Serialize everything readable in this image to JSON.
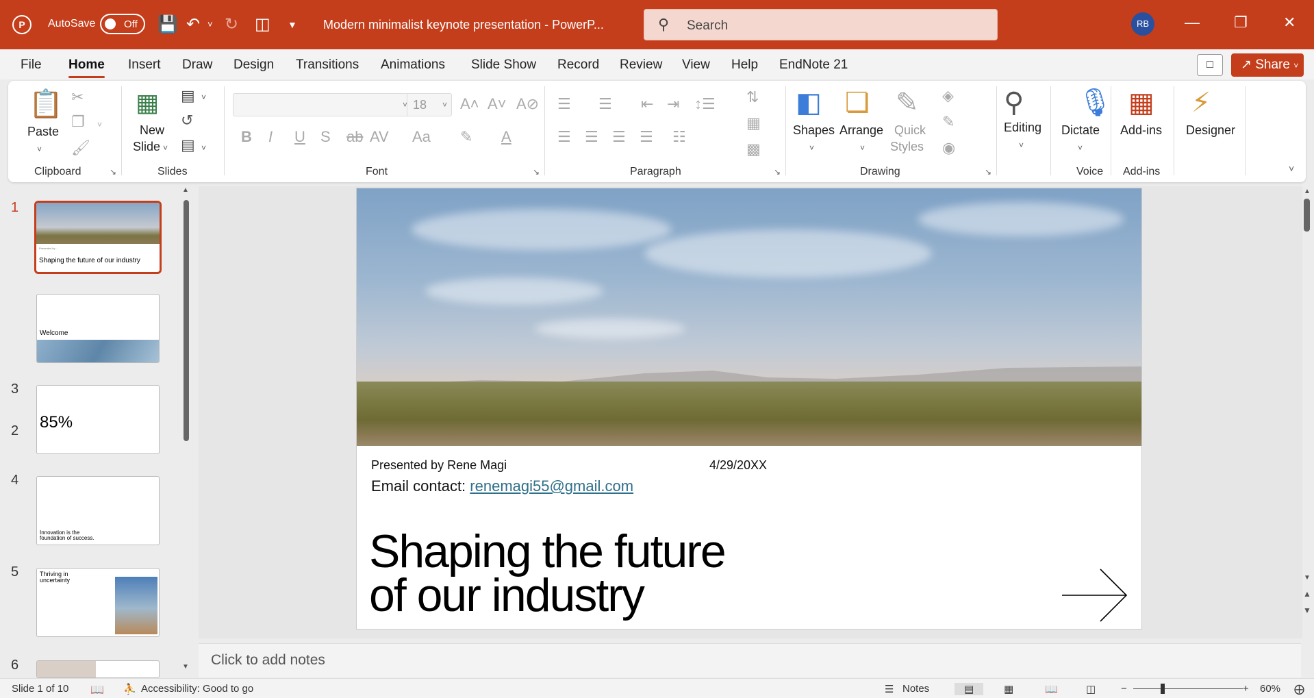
{
  "titlebar": {
    "autosave_label": "AutoSave",
    "autosave_state": "Off",
    "doc_title": "Modern minimalist keynote presentation  -  PowerP...",
    "search_placeholder": "Search",
    "avatar_initials": "RB"
  },
  "menu": {
    "tabs": [
      "File",
      "Home",
      "Insert",
      "Draw",
      "Design",
      "Transitions",
      "Animations",
      "Slide Show",
      "Record",
      "Review",
      "View",
      "Help",
      "EndNote 21"
    ],
    "active": "Home",
    "share_label": "Share"
  },
  "ribbon": {
    "groups": {
      "clipboard": "Clipboard",
      "slides": "Slides",
      "font": "Font",
      "paragraph": "Paragraph",
      "drawing": "Drawing",
      "voice": "Voice",
      "addins": "Add-ins"
    },
    "paste": "Paste",
    "new_slide_1": "New",
    "new_slide_2": "Slide",
    "font_size": "18",
    "shapes": "Shapes",
    "arrange": "Arrange",
    "quick_styles_1": "Quick",
    "quick_styles_2": "Styles",
    "editing": "Editing",
    "dictate": "Dictate",
    "addins_btn": "Add-ins",
    "designer": "Designer"
  },
  "thumbnails": [
    {
      "num": "1",
      "title": "Shaping the future of our industry"
    },
    {
      "num": "2",
      "title": "Welcome"
    },
    {
      "num": "3",
      "title": "85%"
    },
    {
      "num": "4",
      "title": "Innovation is the foundation of success."
    },
    {
      "num": "5",
      "title": "Thriving in uncertainty"
    },
    {
      "num": "6",
      "title": ""
    }
  ],
  "slide": {
    "presented_by": "Presented by Rene Magi",
    "date": "4/29/20XX",
    "email_label": "Email contact: ",
    "email": "renemagi55@gmail.com",
    "title_line1": "Shaping the future",
    "title_line2": "of our industry"
  },
  "notes_placeholder": "Click to add notes",
  "status": {
    "slide_count": "Slide 1 of 10",
    "accessibility": "Accessibility: Good to go",
    "notes": "Notes",
    "zoom": "60%"
  },
  "colors": {
    "accent": "#c43e1c",
    "link": "#2e6f8a"
  }
}
